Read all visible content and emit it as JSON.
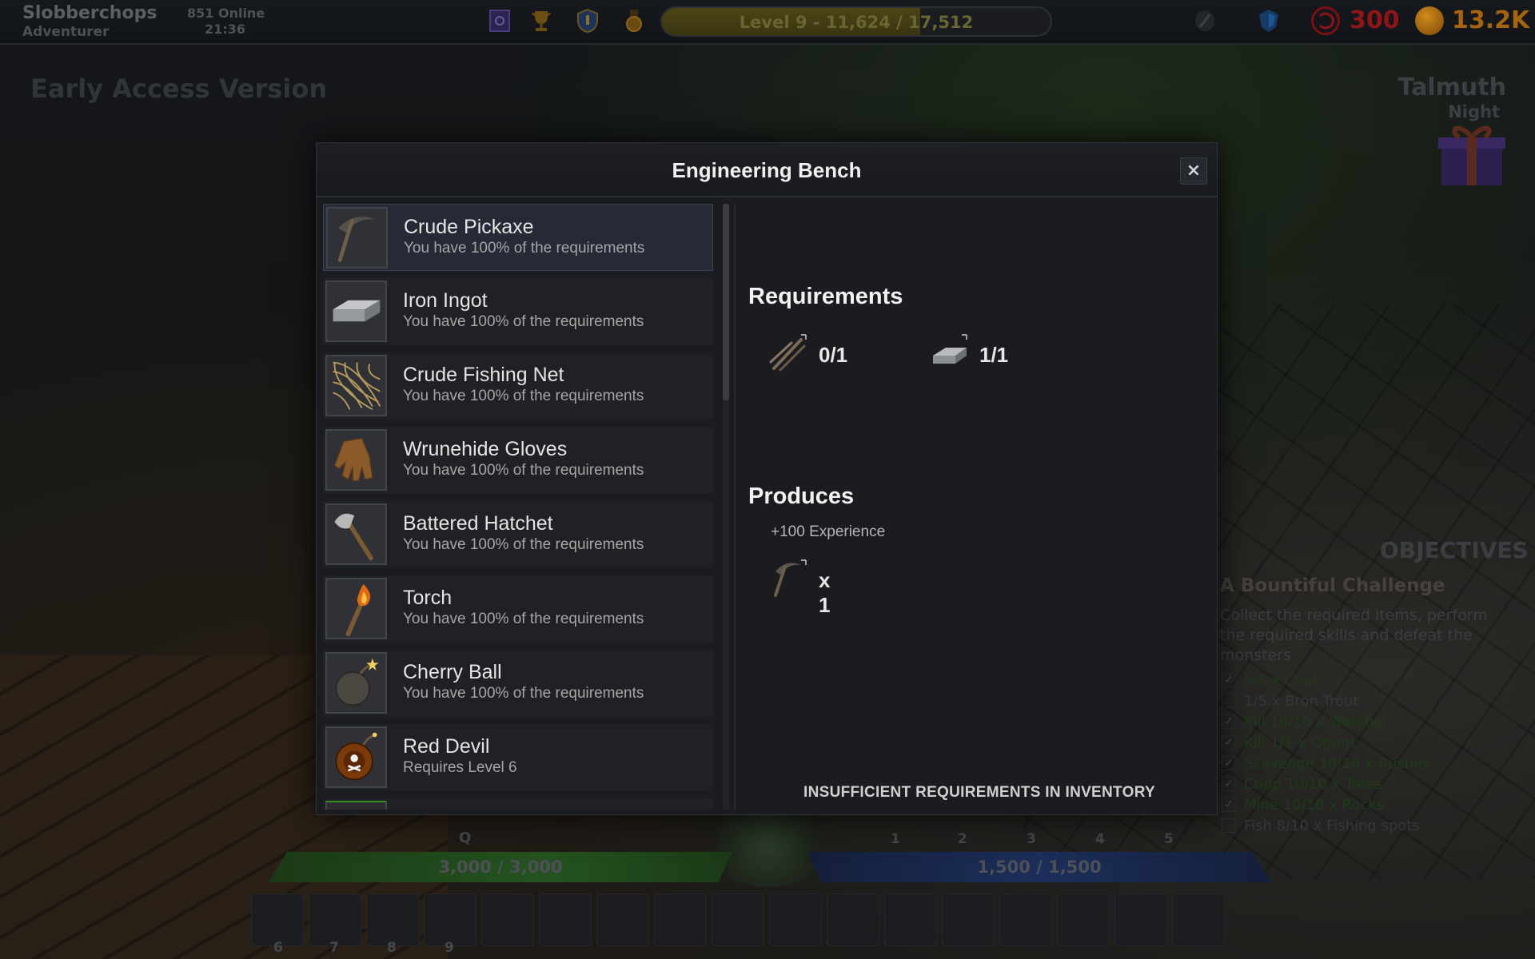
{
  "player": {
    "name": "Slobberchops",
    "title": "Adventurer",
    "online": "851 Online",
    "clock": "21:36"
  },
  "level": {
    "text": "Level  9  - 11,624 / 17,512",
    "progress": 0.664
  },
  "currencies": {
    "red_value": "300",
    "gold_value": "13.2K",
    "red_color": "#a8191c",
    "gold_color": "#c47a12"
  },
  "world": {
    "banner": "Early Access Version",
    "location": "Talmuth",
    "time_of_day": "Night"
  },
  "objectives": {
    "heading": "OBJECTIVES",
    "title": "A Bountiful Challenge",
    "description": "Collect the required items, perform the required skills and defeat the monsters",
    "items": [
      {
        "text": "5/5 x Coal",
        "done": true
      },
      {
        "text": "1/5 x Bron Trout",
        "done": false
      },
      {
        "text": "Kill 10/10 x Watcher",
        "done": true
      },
      {
        "text": "Kill 1/1 x Ogum",
        "done": true
      },
      {
        "text": "Scavenge 10/10 x Bushes",
        "done": true
      },
      {
        "text": "Chop 10/10 x Trees",
        "done": true
      },
      {
        "text": "Mine 10/10 x Rocks",
        "done": true
      },
      {
        "text": "Fish 8/10 x Fishing spots",
        "done": false
      }
    ]
  },
  "hud": {
    "q_key": "Q",
    "hp_text": "3,000 / 3,000",
    "mp_text": "1,500 / 1,500",
    "skill_keys": [
      "1",
      "2",
      "3",
      "4",
      "5"
    ],
    "slot_numbers": [
      "6",
      "7",
      "8",
      "9"
    ]
  },
  "modal": {
    "title": "Engineering Bench",
    "close_label": "×",
    "recipes": [
      {
        "name": "Crude Pickaxe",
        "status": "You have 100% of the requirements",
        "icon": "pickaxe-icon"
      },
      {
        "name": "Iron Ingot",
        "status": "You have 100% of the requirements",
        "icon": "ingot-icon"
      },
      {
        "name": "Crude Fishing Net",
        "status": "You have 100% of the requirements",
        "icon": "fishing-net-icon"
      },
      {
        "name": "Wrunehide Gloves",
        "status": "You have 100% of the requirements",
        "icon": "gloves-icon"
      },
      {
        "name": "Battered Hatchet",
        "status": "You have 100% of the requirements",
        "icon": "hatchet-icon"
      },
      {
        "name": "Torch",
        "status": "You have 100% of the requirements",
        "icon": "torch-icon"
      },
      {
        "name": "Cherry Ball",
        "status": "You have 100% of the requirements",
        "icon": "bomb-icon"
      },
      {
        "name": "Red Devil",
        "status": "Requires Level 6",
        "icon": "red-bomb-icon"
      }
    ],
    "requirements_title": "Requirements",
    "requirements": [
      {
        "icon": "sticks-icon",
        "count": "0/1"
      },
      {
        "icon": "ingot-icon",
        "count": "1/1"
      }
    ],
    "produces_title": "Produces",
    "experience": "+100 Experience",
    "produce_item": {
      "icon": "pickaxe-icon",
      "count": "x 1"
    },
    "footer_message": "INSUFFICIENT REQUIREMENTS IN INVENTORY"
  }
}
